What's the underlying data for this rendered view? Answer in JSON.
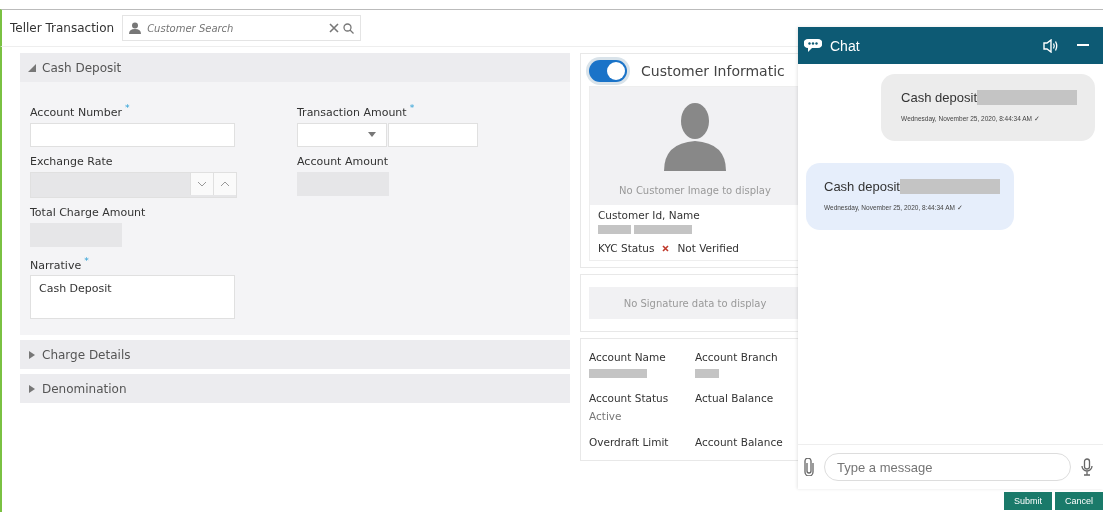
{
  "header": {
    "title": "Teller Transaction",
    "search": {
      "placeholder": "Customer Search"
    }
  },
  "sections": [
    {
      "title": "Cash Deposit",
      "expanded": true
    },
    {
      "title": "Charge Details",
      "expanded": false
    },
    {
      "title": "Denomination",
      "expanded": false
    }
  ],
  "form": {
    "account_number": {
      "label": "Account Number",
      "required_mark": "*"
    },
    "transaction_amount": {
      "label": "Transaction Amount",
      "required_mark": "*"
    },
    "exchange_rate": {
      "label": "Exchange Rate",
      "disabled": true
    },
    "account_amount": {
      "label": "Account Amount",
      "disabled": true
    },
    "total_charge_amount": {
      "label": "Total Charge Amount",
      "disabled": true
    },
    "narrative": {
      "label": "Narrative",
      "required_mark": "*",
      "value": "Cash Deposit"
    }
  },
  "customer_info": {
    "toggle_on": true,
    "title": "Customer Informatic",
    "image_text": "No Customer Image to display",
    "id_label": "Customer Id, Name",
    "kyc_label": "KYC Status",
    "kyc_value": "Not Verified",
    "signature_text": "No Signature data to display"
  },
  "account_fields": [
    {
      "label": "Account Name",
      "redacted": true
    },
    {
      "label": "Account Branch",
      "redacted": true
    },
    {
      "label": "Account Status",
      "value": "Active"
    },
    {
      "label": "Actual Balance"
    },
    {
      "label": "Overdraft Limit"
    },
    {
      "label": "Account Balance"
    }
  ],
  "chat": {
    "title": "Chat",
    "messages": [
      {
        "kind": "outgoing",
        "text": "Cash deposit",
        "time": "Wednesday, November 25, 2020, 8:44:34 AM ✓"
      },
      {
        "kind": "incoming",
        "text": "Cash deposit",
        "time": "Wednesday, November 25, 2020, 8:44:34 AM ✓"
      }
    ],
    "input": {
      "placeholder": "Type a message"
    }
  },
  "footer_buttons": [
    "Submit",
    "Cancel"
  ]
}
